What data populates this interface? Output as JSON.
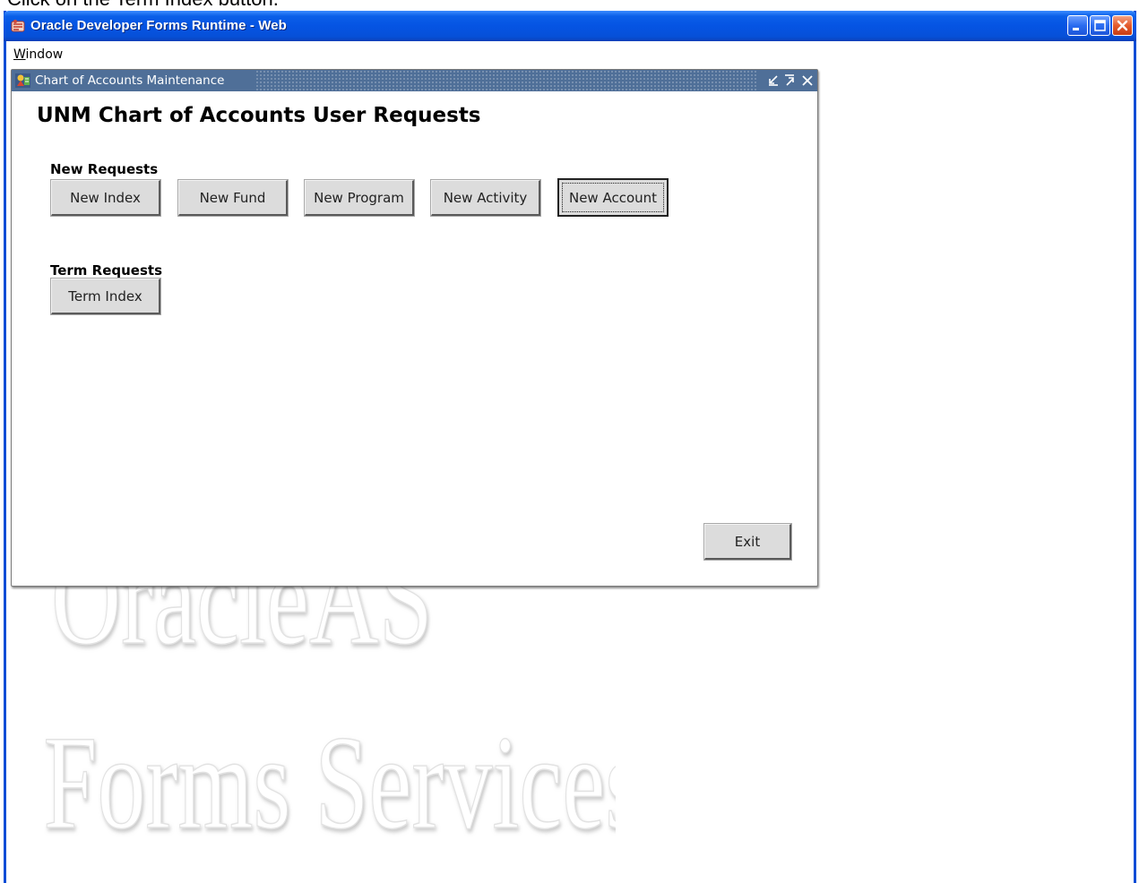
{
  "instruction": "Click on the Term Index button.",
  "window": {
    "title": "Oracle Developer Forms Runtime - Web",
    "menu": [
      {
        "label": "Window",
        "mnemonic": "W",
        "rest": "indow"
      }
    ],
    "title_bar_color": "#0554e3"
  },
  "watermark": {
    "line1": "OracleAS",
    "line2": "Forms Services"
  },
  "form": {
    "title": "Chart of Accounts Maintenance",
    "heading": "UNM Chart of Accounts User Requests",
    "new_requests_label": "New Requests",
    "new_buttons": [
      {
        "label": "New Index"
      },
      {
        "label": "New Fund"
      },
      {
        "label": "New Program"
      },
      {
        "label": "New Activity"
      },
      {
        "label": "New Account",
        "focused": true
      }
    ],
    "term_requests_label": "Term Requests",
    "term_buttons": [
      {
        "label": "Term Index"
      }
    ],
    "exit_label": "Exit",
    "title_bar_color": "#4f6f98"
  }
}
